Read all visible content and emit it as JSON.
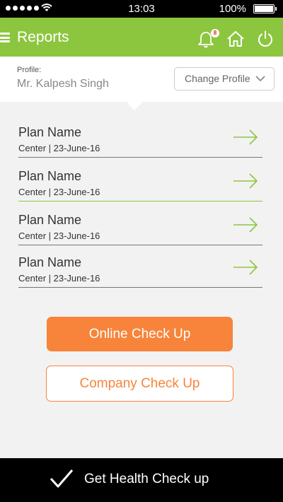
{
  "status_bar": {
    "time": "13:03",
    "battery": "100%"
  },
  "header": {
    "title": "Reports",
    "notification_count": "8",
    "accent_color": "#8cc63f"
  },
  "profile": {
    "label": "Profile:",
    "name": "Mr. Kalpesh Singh",
    "change_label": "Change Profile"
  },
  "plans": [
    {
      "name": "Plan Name",
      "center": "Center",
      "date": "23-June-16"
    },
    {
      "name": "Plan Name",
      "center": "Center",
      "date": "23-June-16"
    },
    {
      "name": "Plan Name",
      "center": "Center",
      "date": "23-June-16"
    },
    {
      "name": "Plan Name",
      "center": "Center",
      "date": "23-June-16"
    }
  ],
  "actions": {
    "online_label": "Online Check Up",
    "company_label": "Company Check Up",
    "button_color": "#f7843a"
  },
  "footer": {
    "label": "Get Health Check up"
  },
  "icons": [
    "menu-icon",
    "bell-icon",
    "home-icon",
    "power-icon",
    "chevron-down-icon",
    "arrow-right-icon",
    "checkmark-icon"
  ]
}
